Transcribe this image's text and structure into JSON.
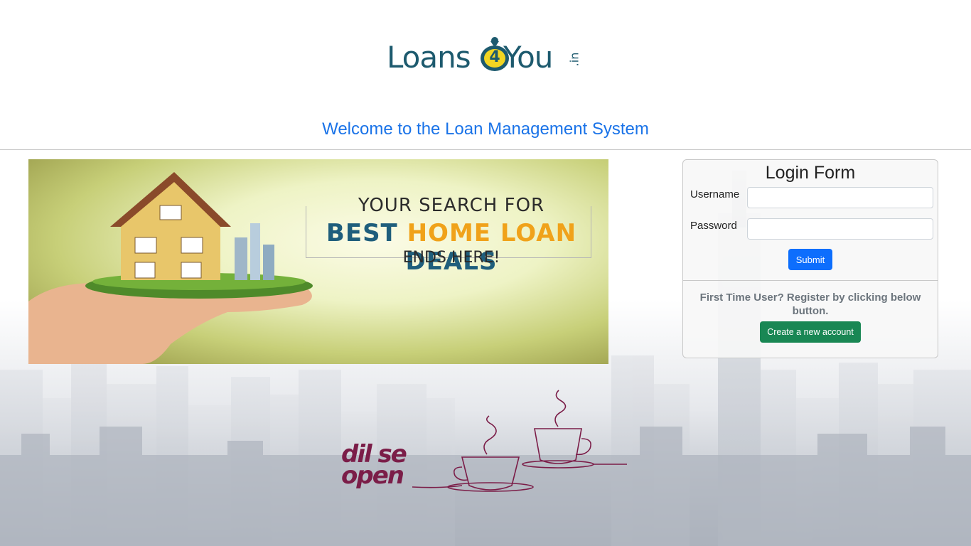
{
  "brand": {
    "logo_left": "Loans",
    "logo_number": "4",
    "logo_right": "You",
    "logo_suffix": ".in",
    "color": "#1d5a6e"
  },
  "header": {
    "welcome": "Welcome to the Loan Management System",
    "welcome_color": "#1a73e8"
  },
  "banner": {
    "line1": "YOUR SEARCH FOR",
    "line2_a": "BEST",
    "line2_b": "HOME LOAN",
    "line2_c": "DEALS",
    "line3": "ENDS HERE!"
  },
  "login": {
    "title": "Login Form",
    "username_label": "Username",
    "password_label": "Password",
    "username_value": "",
    "password_value": "",
    "submit_label": "Submit",
    "register_text": "First Time User? Register by clicking below button.",
    "create_label": "Create a new account",
    "submit_color": "#0d6efd",
    "create_color": "#198754"
  },
  "promo": {
    "line1": "dil se",
    "line2": "open",
    "color": "#7b1d48"
  }
}
